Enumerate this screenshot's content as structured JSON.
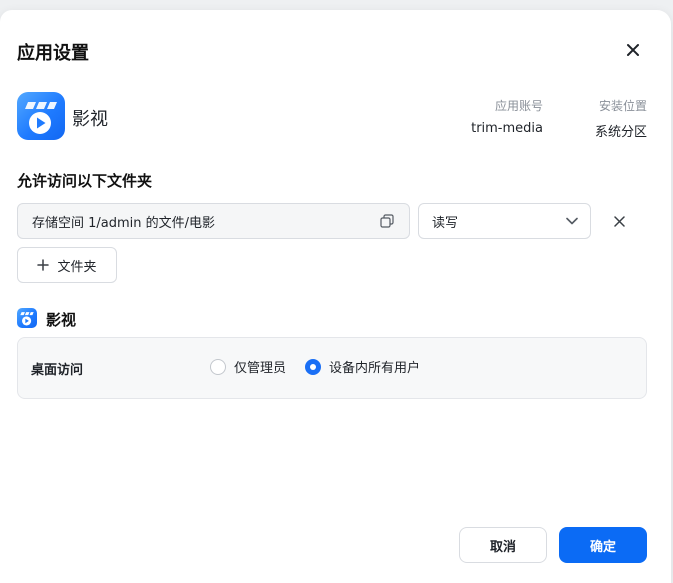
{
  "dialog": {
    "title": "应用设置",
    "close_icon": "close-icon"
  },
  "app": {
    "name": "影视",
    "icon": "film-app-icon",
    "brand_color": "#1f7bff",
    "account_label": "应用账号",
    "account_value": "trim-media",
    "location_label": "安装位置",
    "location_value": "系统分区"
  },
  "folders": {
    "section_title": "允许访问以下文件夹",
    "rows": [
      {
        "path": "存储空间 1/admin 的文件/电影",
        "permission": "读写"
      }
    ],
    "add_label": "文件夹"
  },
  "permissions": {
    "section_title": "影视",
    "desktop_access_label": "桌面访问",
    "options": [
      {
        "label": "仅管理员",
        "selected": false
      },
      {
        "label": "设备内所有用户",
        "selected": true
      }
    ]
  },
  "footer": {
    "cancel_label": "取消",
    "confirm_label": "确定",
    "primary_color": "#0b6bf5"
  }
}
